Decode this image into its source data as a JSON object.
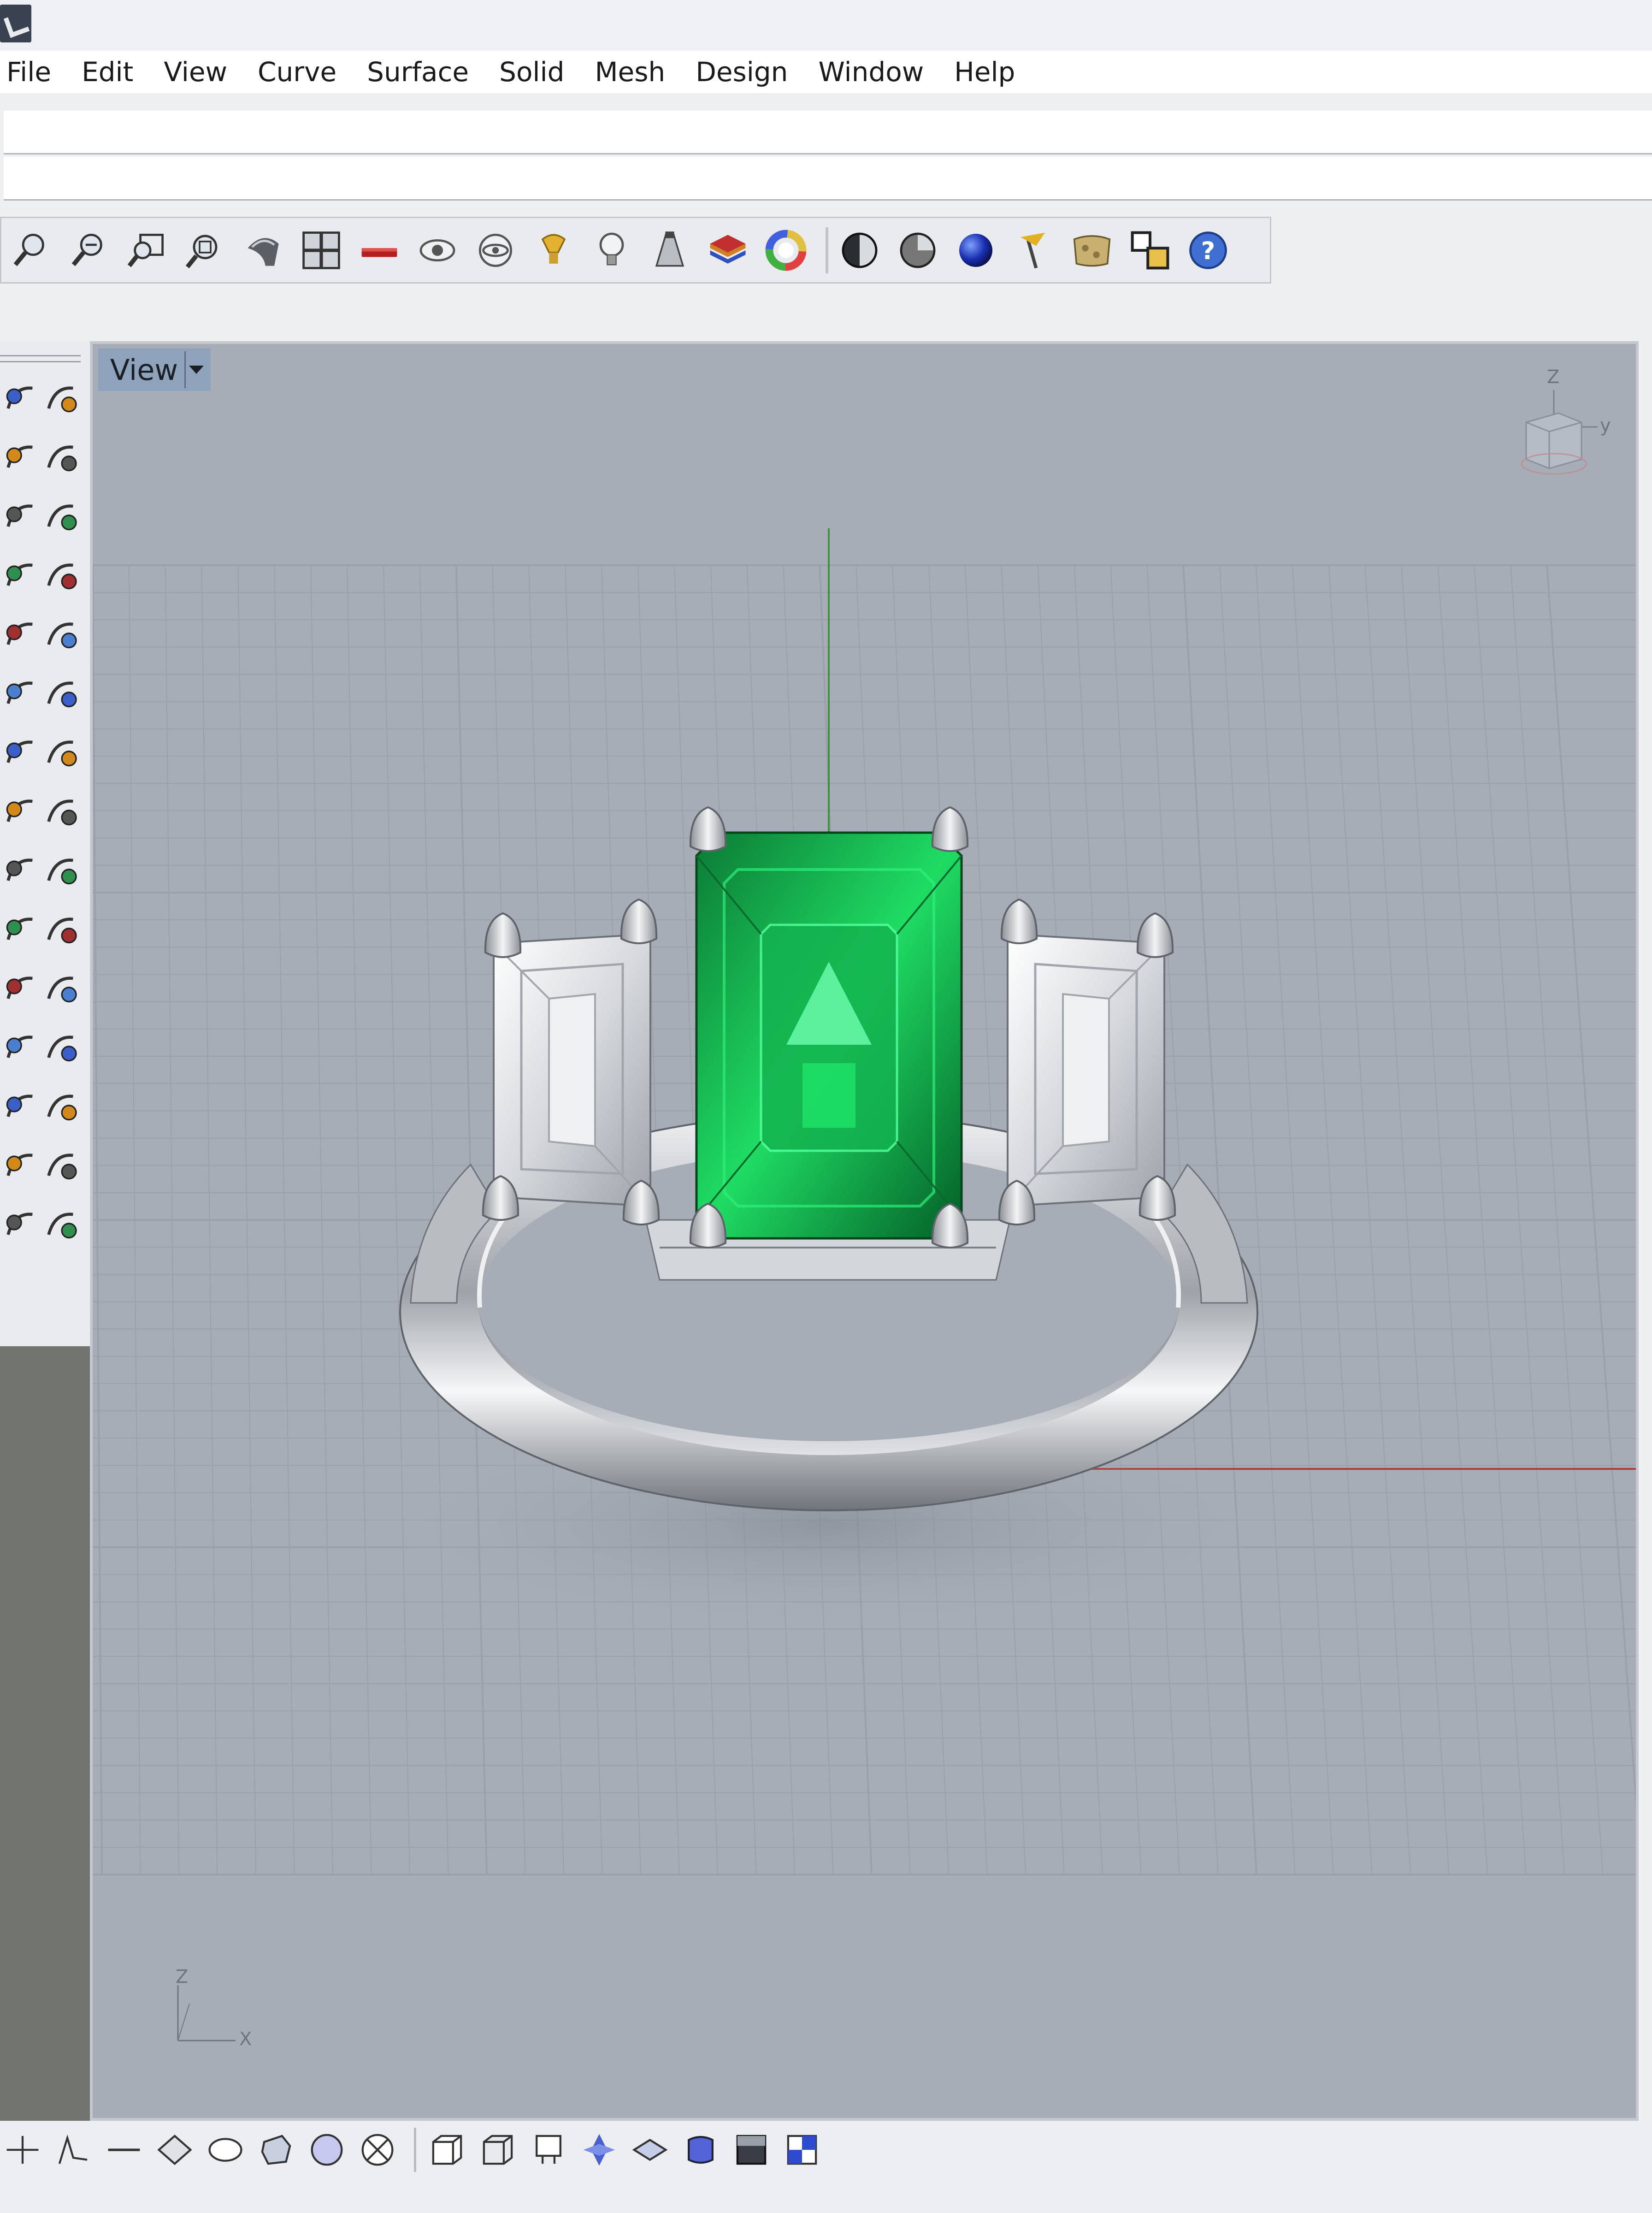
{
  "menu": {
    "items": [
      "File",
      "Edit",
      "View",
      "Curve",
      "Surface",
      "Solid",
      "Mesh",
      "Design",
      "Window",
      "Help"
    ]
  },
  "command": {
    "line1": "",
    "line2": ""
  },
  "viewport": {
    "tab_label": "View",
    "gumball_axes": {
      "z": "Z",
      "y": "y"
    },
    "world_axes": {
      "z": "Z",
      "x": "X"
    }
  },
  "toolbar": {
    "icons": [
      "zoom-icon",
      "zoom-out-icon",
      "zoom-window-icon",
      "zoom-extents-icon",
      "render-mode-icon",
      "four-viewports-icon",
      "ruler-icon",
      "hide-icon",
      "show-icon",
      "spotlight-icon",
      "bulb-icon",
      "cone-light-icon",
      "layers-icon",
      "color-wheel-icon",
      "separator",
      "shaded-icon",
      "ghosted-icon",
      "render-sphere-icon",
      "flag-icon",
      "material-icon",
      "properties-icon",
      "help-icon"
    ]
  },
  "colors": {
    "viewport_bg": "#a7adb7",
    "grid_line": "#9aa1ab",
    "x_axis": "#b23a3a",
    "y_axis": "#3f8f3f",
    "emerald": "#10a84a",
    "metal": "#c9ccd0"
  }
}
